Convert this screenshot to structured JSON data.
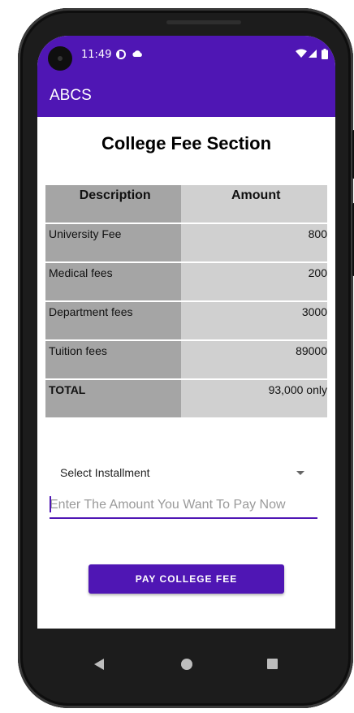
{
  "status_bar": {
    "time": "11:49",
    "left_icons": [
      "app-notification-icon",
      "cloud-icon"
    ],
    "right_icons": [
      "wifi-icon",
      "signal-icon",
      "battery-icon"
    ]
  },
  "app_bar": {
    "title": "ABCS"
  },
  "page": {
    "title": "College Fee Section"
  },
  "fee_table": {
    "headers": [
      "Description",
      "Amount"
    ],
    "rows": [
      {
        "description": "University Fee",
        "amount": "800"
      },
      {
        "description": "Medical fees",
        "amount": "200"
      },
      {
        "description": "Department fees",
        "amount": "3000"
      },
      {
        "description": "Tuition fees",
        "amount": "89000"
      }
    ],
    "total": {
      "label": "TOTAL",
      "amount": "93,000 only"
    }
  },
  "installment_dropdown": {
    "selected": "Select Installment"
  },
  "amount_input": {
    "placeholder": "Enter The Amount You Want To Pay Now",
    "value": ""
  },
  "pay_button": {
    "label": "PAY COLLEGE FEE"
  },
  "colors": {
    "primary": "#4f16b4",
    "description_column": "#a5a5a5",
    "amount_column": "#d0d0d0"
  },
  "nav_bar": {
    "icons": [
      "back-icon",
      "home-icon",
      "recents-icon"
    ]
  }
}
